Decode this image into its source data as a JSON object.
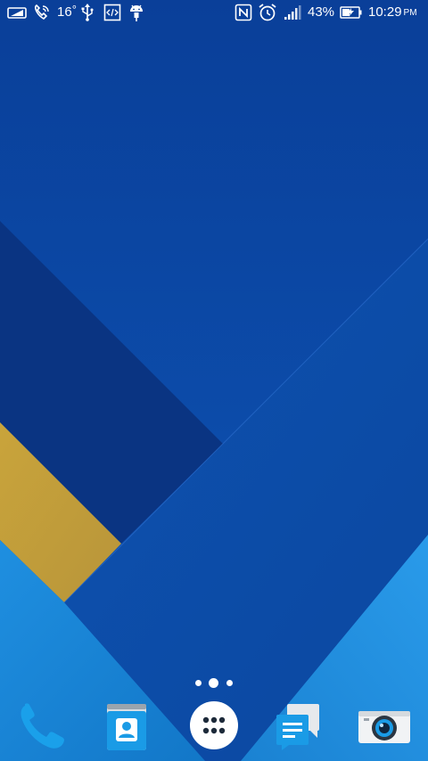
{
  "status_bar": {
    "temperature": "16",
    "temperature_unit": "°",
    "battery_percent": "43%",
    "time": "10:29",
    "time_period": "PM",
    "icons": [
      "battery-saver-icon",
      "call-icon",
      "usb-icon",
      "developer-code-icon",
      "android-debug-icon",
      "nfc-icon",
      "alarm-clock-icon",
      "cellular-signal-icon",
      "battery-charging-icon"
    ]
  },
  "home": {
    "page_count": 3,
    "current_page_index": 1
  },
  "dock": {
    "apps": [
      {
        "name": "phone",
        "icon": "phone-icon"
      },
      {
        "name": "contacts",
        "icon": "contacts-icon"
      },
      {
        "name": "app-drawer",
        "icon": "app-drawer-icon"
      },
      {
        "name": "messages",
        "icon": "messages-icon"
      },
      {
        "name": "camera",
        "icon": "camera-icon"
      }
    ]
  },
  "colors": {
    "wallpaper_base": "#0b47a6",
    "wallpaper_dark": "#0a3480",
    "wallpaper_gold": "#c7a53c",
    "wallpaper_light": "#1b8ad8",
    "icon_blue": "#1a9be6"
  }
}
